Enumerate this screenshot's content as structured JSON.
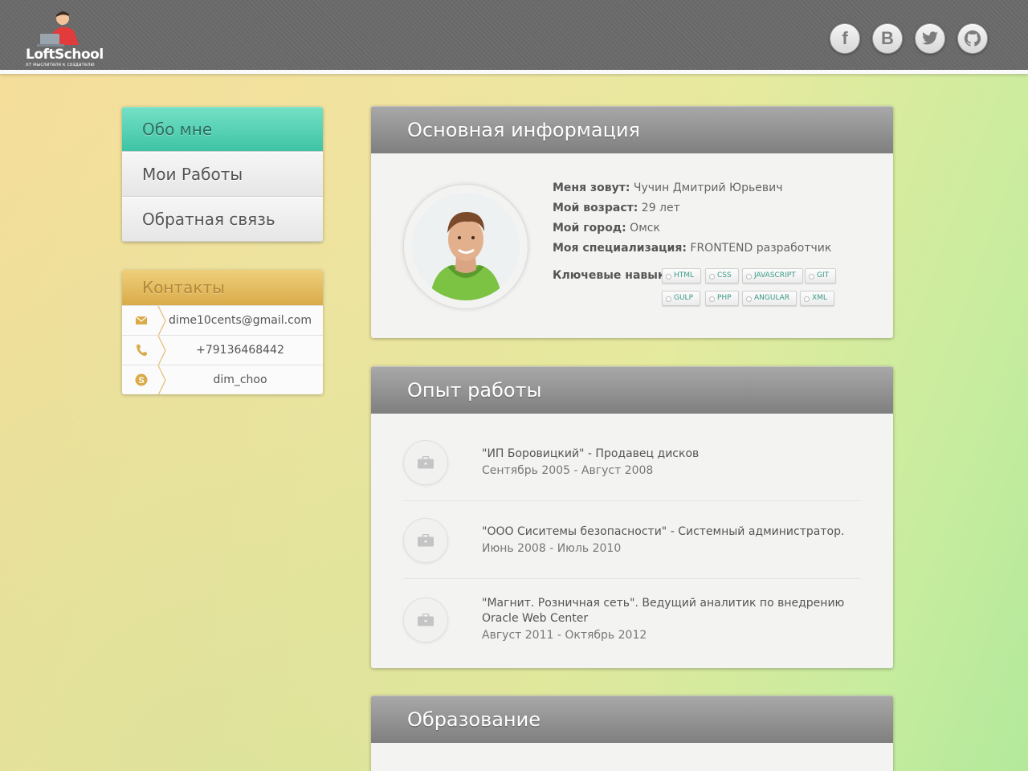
{
  "header": {
    "logo_title": "LoftSchool",
    "logo_subtitle": "от мыслителя к создателю",
    "socials": [
      {
        "name": "facebook-icon",
        "glyph": "f"
      },
      {
        "name": "vk-icon",
        "glyph": "B"
      },
      {
        "name": "twitter-icon",
        "glyph": ""
      },
      {
        "name": "github-icon",
        "glyph": ""
      }
    ]
  },
  "menu": {
    "items": [
      {
        "label": "Обо мне",
        "active": true
      },
      {
        "label": "Мои Работы",
        "active": false
      },
      {
        "label": "Обратная связь",
        "active": false
      }
    ]
  },
  "contacts": {
    "title": "Контакты",
    "email": "dime10cents@gmail.com",
    "phone": "+79136468442",
    "skype": "dim_choo"
  },
  "about": {
    "title": "Основная информация",
    "name_label": "Меня зовут:",
    "name_value": "Чучин Дмитрий Юрьевич",
    "age_label": "Мой возраст:",
    "age_value": "29 лет",
    "city_label": "Мой город:",
    "city_value": "Омск",
    "spec_label": "Моя специализация:",
    "spec_value": "FRONTEND разработчик",
    "skills_label": "Ключевые навыки:",
    "skills": [
      "HTML",
      "CSS",
      "JAVASCRIPT",
      "GIT",
      "GULP",
      "PHP",
      "ANGULAR",
      "XML"
    ]
  },
  "experience": {
    "title": "Опыт работы",
    "jobs": [
      {
        "title": "\"ИП Боровицкий\" - Продавец дисков",
        "period": "Сентябрь 2005 - Август 2008"
      },
      {
        "title": "\"ООО Сиситемы безопасности\" - Системный администратор.",
        "period": "Июнь 2008 - Июль 2010"
      },
      {
        "title": "\"Магнит. Розничная сеть\". Ведущий аналитик по внедрению Oracle Web Center",
        "period": "Август 2011 - Октябрь 2012"
      }
    ]
  },
  "education": {
    "title": "Образование"
  },
  "colors": {
    "accent_teal": "#3ec4a4",
    "accent_gold": "#d9ab49",
    "header_gray": "#6a6a6a"
  }
}
